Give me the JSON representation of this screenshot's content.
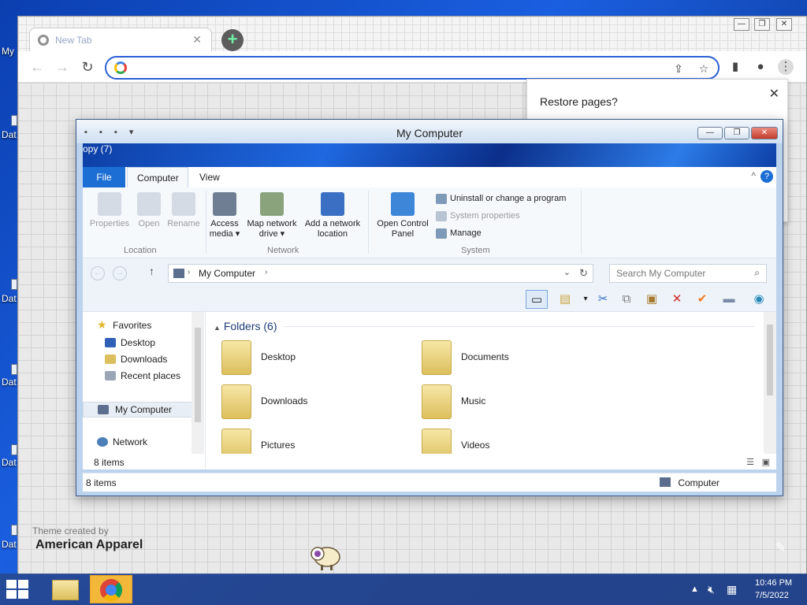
{
  "desktop": {
    "left_labels": [
      "My",
      "Dat",
      "",
      "Dat",
      "-",
      "Dat",
      "-",
      "Dat",
      "-",
      "Dat",
      "-",
      "Dat",
      "-"
    ]
  },
  "chrome": {
    "tab": {
      "title": "New Tab",
      "close": "✕"
    },
    "new_tab": "+",
    "window_controls": [
      "—",
      "❐",
      "✕"
    ],
    "nav": {
      "back": "←",
      "forward": "→",
      "reload": "↻"
    },
    "omnibox": {
      "value": "",
      "placeholder": ""
    },
    "restore_popup": {
      "title": "Restore pages?",
      "close": "✕"
    },
    "theme_credit": {
      "line1": "Theme created by",
      "line2": "American Apparel"
    }
  },
  "explorer": {
    "title": "My Computer",
    "banner_text": "opy (7)",
    "window_controls": [
      "—",
      "❐",
      "✕"
    ],
    "ribbon_tabs": [
      "File",
      "Computer",
      "View"
    ],
    "location_group": {
      "label": "Location",
      "buttons": [
        "Properties",
        "Open",
        "Rename"
      ]
    },
    "network_group": {
      "label": "Network",
      "buttons": [
        {
          "line1": "Access",
          "line2": "media ▾"
        },
        {
          "line1": "Map network",
          "line2": "drive ▾"
        },
        {
          "line1": "Add a network",
          "line2": "location"
        }
      ]
    },
    "system_group": {
      "label": "System",
      "open_control_panel": {
        "line1": "Open Control",
        "line2": "Panel"
      },
      "items": [
        "Uninstall or change a program",
        "System properties",
        "Manage"
      ]
    },
    "address": {
      "path": "My Computer",
      "search_placeholder": "Search My Computer"
    },
    "nav_pane": {
      "favorites": "Favorites",
      "items": [
        "Desktop",
        "Downloads",
        "Recent places"
      ],
      "my_computer": "My Computer",
      "network": "Network"
    },
    "folders_header": "Folders (6)",
    "folders": [
      "Desktop",
      "Documents",
      "Downloads",
      "Music",
      "Pictures",
      "Videos"
    ],
    "item_count_inner": "8 items",
    "status": {
      "left": "8 items",
      "right": "Computer"
    }
  },
  "taskbar": {
    "time": "10:46 PM",
    "date": "7/5/2022"
  }
}
